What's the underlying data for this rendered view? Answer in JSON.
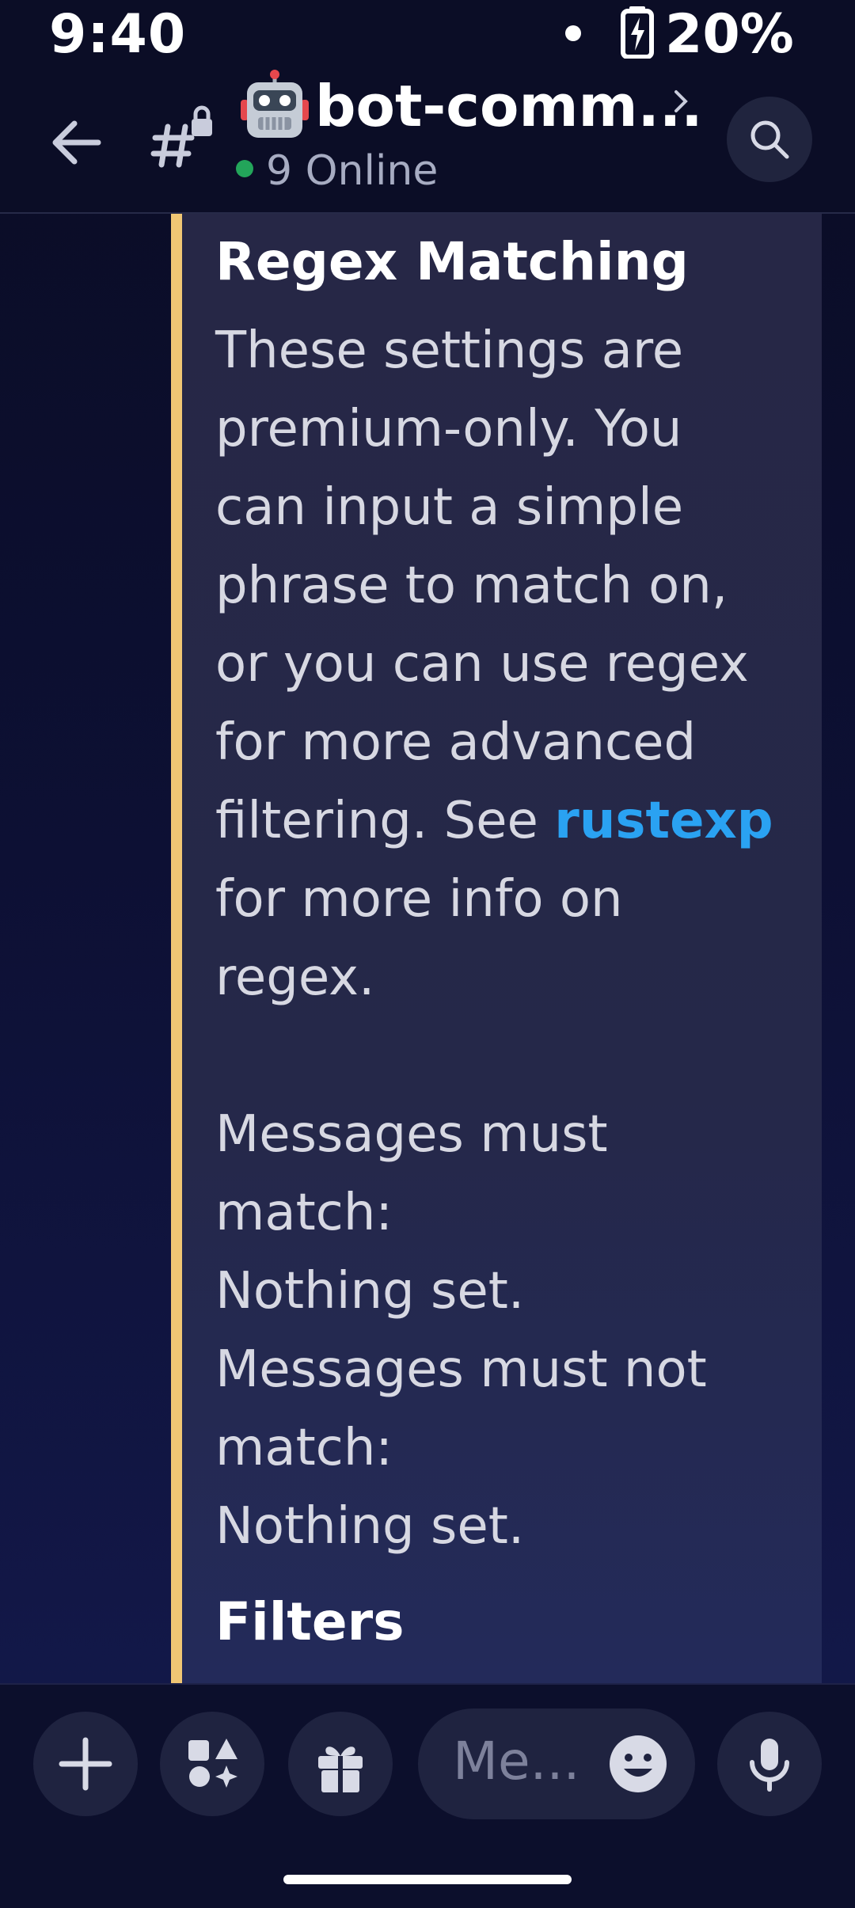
{
  "status_bar": {
    "time": "9:40",
    "battery_percent": "20%"
  },
  "header": {
    "channel_name": "bot-comm...",
    "online_count": "9 Online"
  },
  "embed": {
    "accent_color": "#f0c674",
    "title": "Regex Matching",
    "paragraphs": [
      "These settings are premium-only. You can input a simple phrase to match on, or you can use regex for more advanced filtering. See",
      "for more info on regex."
    ],
    "link_text": "rustexp",
    "must_match_label": "Messages must match:",
    "must_match_value": "Nothing set.",
    "must_not_match_label": "Messages must not match:",
    "must_not_match_value": "Nothing set.",
    "next_section_title": "Filters"
  },
  "composer": {
    "message_placeholder": "Me..."
  },
  "icons": {
    "back": "arrow-left-icon",
    "channel": "locked-hash-icon",
    "channel_emoji": "robot-emoji",
    "search": "search-icon",
    "add": "plus-icon",
    "apps": "apps-shapes-icon",
    "gift": "gift-icon",
    "emoji": "emoji-smiley-icon",
    "mic": "microphone-icon"
  }
}
